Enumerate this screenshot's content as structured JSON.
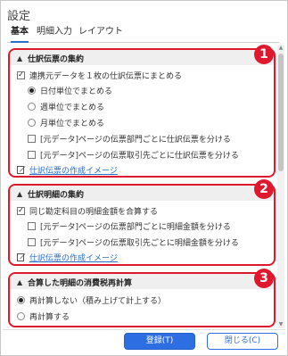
{
  "window": {
    "title": "設定"
  },
  "tabs": [
    {
      "label": "基本",
      "active": true
    },
    {
      "label": "明細入力",
      "active": false
    },
    {
      "label": "レイアウト",
      "active": false
    }
  ],
  "sections": [
    {
      "badge": "1",
      "header": "仕訳伝票の集約",
      "main_checkbox": {
        "label": "連携元データを１枚の仕訳伝票にまとめる",
        "checked": true
      },
      "radios": [
        {
          "label": "日付単位でまとめる",
          "selected": true
        },
        {
          "label": "週単位でまとめる",
          "selected": false
        },
        {
          "label": "月単位でまとめる",
          "selected": false
        }
      ],
      "checkboxes": [
        {
          "label": "[元データ]ページの伝票部門ごとに仕訳伝票を分ける",
          "checked": false
        },
        {
          "label": "[元データ]ページの伝票取引先ごとに仕訳伝票を分ける",
          "checked": false
        }
      ],
      "link": "仕訳伝票の作成イメージ"
    },
    {
      "badge": "2",
      "header": "仕訳明細の集約",
      "main_checkbox": {
        "label": "同じ勘定科目の明細金額を合算する",
        "checked": true
      },
      "checkboxes": [
        {
          "label": "[元データ]ページの伝票部門ごとに明細金額を分ける",
          "checked": false
        },
        {
          "label": "[元データ]ページの伝票取引先ごとに明細金額を分ける",
          "checked": false
        }
      ],
      "link": "仕訳伝票の作成イメージ"
    },
    {
      "badge": "3",
      "header": "合算した明細の消費税再計算",
      "radios": [
        {
          "label": "再計算しない（積み上げて計上する）",
          "selected": true
        },
        {
          "label": "再計算する",
          "selected": false
        }
      ]
    }
  ],
  "footer": {
    "ok_label": "登録(T)",
    "close_label": "閉じる(C)"
  },
  "colors": {
    "accent": "#2d6fe3",
    "highlight": "#e0182d"
  }
}
